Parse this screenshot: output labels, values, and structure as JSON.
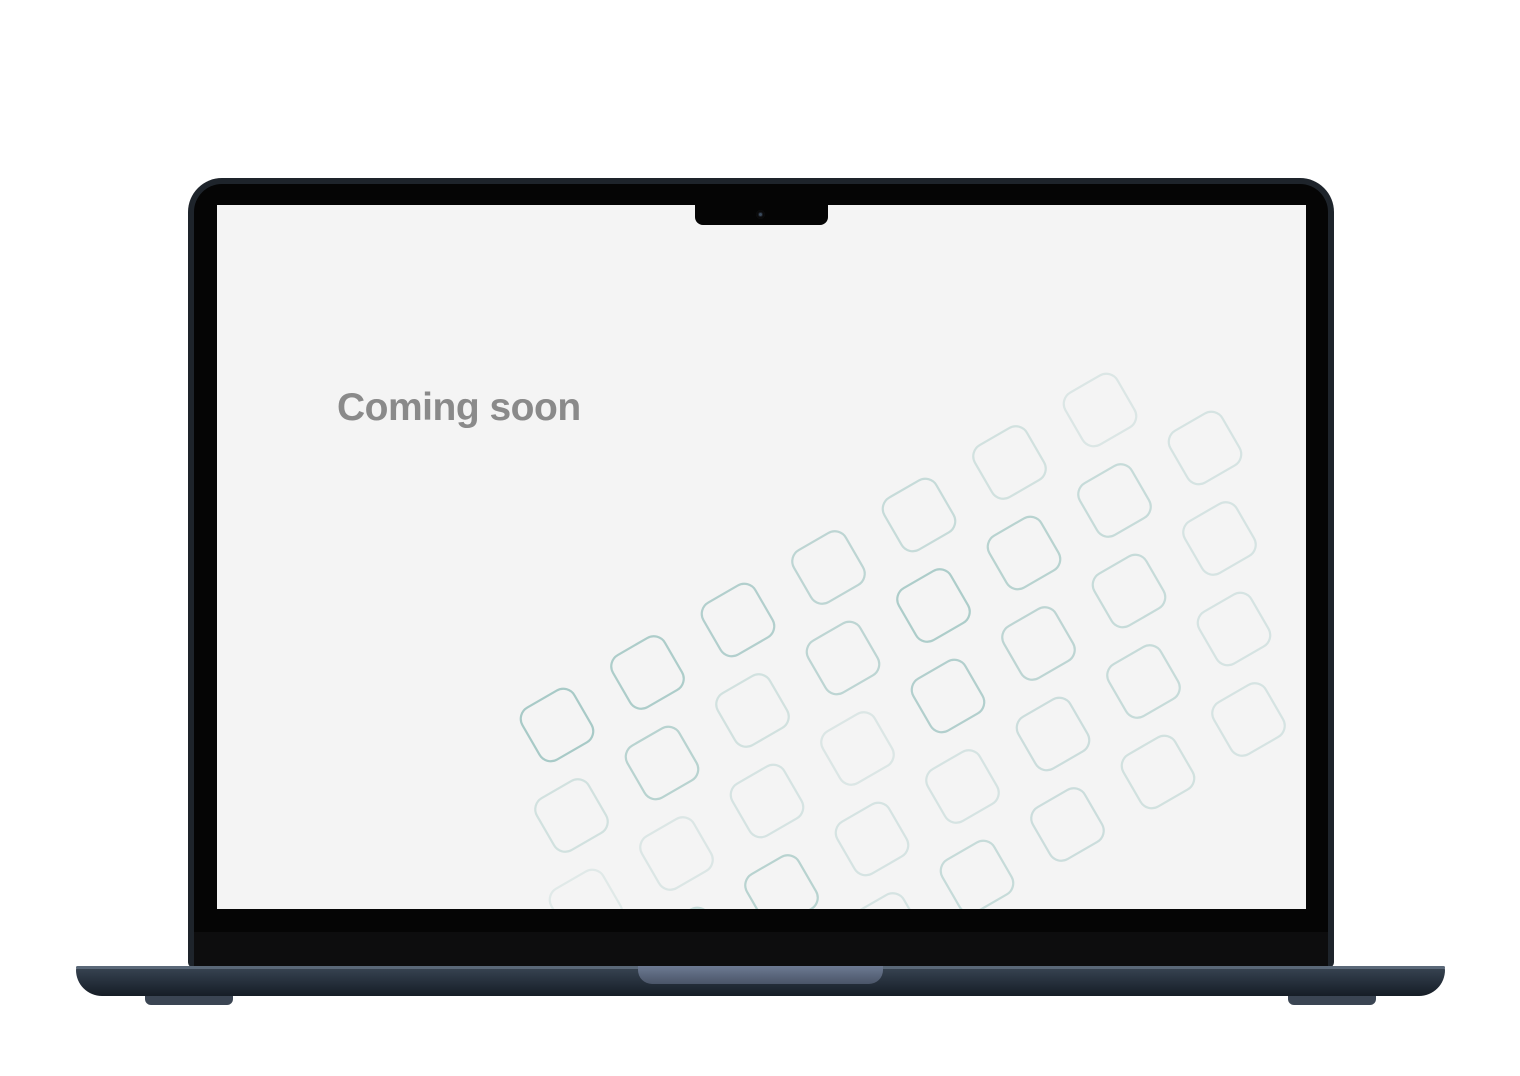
{
  "screen": {
    "headline": "Coming soon"
  },
  "colors": {
    "screen_bg": "#f4f4f4",
    "headline": "#8a8a8a",
    "pattern_stroke": "#8fbcb8",
    "bezel": "#050505",
    "frame": "#1e242b"
  },
  "icons": {
    "camera": "webcam-icon",
    "pattern": "rounded-square-outline-icon"
  }
}
